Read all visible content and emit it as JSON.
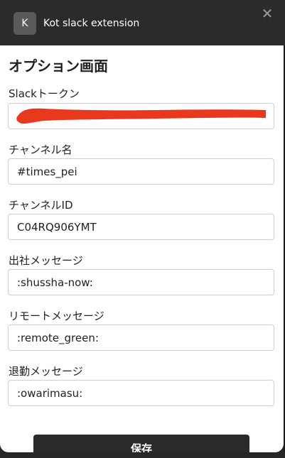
{
  "header": {
    "avatar_letter": "K",
    "extension_name": "Kot slack extension",
    "close_glyph": "✕",
    "close_icon": "close-icon"
  },
  "page": {
    "title": "オプション画面"
  },
  "fields": {
    "slack_token": {
      "label": "Slackトークン",
      "value": "",
      "redacted": true
    },
    "channel_name": {
      "label": "チャンネル名",
      "value": "#times_pei"
    },
    "channel_id": {
      "label": "チャンネルID",
      "value": "C04RQ906YMT"
    },
    "checkin_message": {
      "label": "出社メッセージ",
      "value": ":shussha-now:"
    },
    "remote_message": {
      "label": "リモートメッセージ",
      "value": ":remote_green:"
    },
    "checkout_message": {
      "label": "退勤メッセージ",
      "value": ":owarimasu:"
    }
  },
  "actions": {
    "save_label": "保存"
  },
  "colors": {
    "header_bg": "#2b2b2b",
    "panel_bg": "#ffffff",
    "button_bg": "#2a2a2a",
    "redaction": "#e8391f"
  }
}
